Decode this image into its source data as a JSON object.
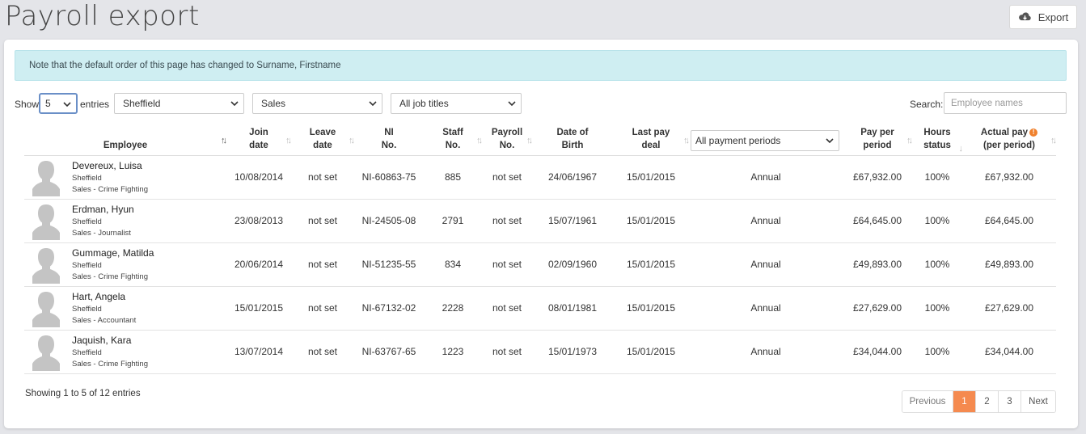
{
  "page": {
    "title": "Payroll export"
  },
  "toolbar": {
    "export_label": "Export"
  },
  "notice": "Note that the default order of this page has changed to Surname, Firstname",
  "filters": {
    "show_label": "Show",
    "page_length": "5",
    "entries_label": "entries",
    "location": "Sheffield",
    "department": "Sales",
    "job_title": "All job titles",
    "search_label": "Search:",
    "search_placeholder": "Employee names",
    "payment_period": "All payment periods"
  },
  "columns": {
    "employee": "Employee",
    "join_date_1": "Join",
    "join_date_2": "date",
    "leave_date_1": "Leave",
    "leave_date_2": "date",
    "ni_1": "NI",
    "ni_2": "No.",
    "staff_1": "Staff",
    "staff_2": "No.",
    "payroll_1": "Payroll",
    "payroll_2": "No.",
    "dob_1": "Date of",
    "dob_2": "Birth",
    "lastpay_1": "Last pay",
    "lastpay_2": "deal",
    "payper_1": "Pay per",
    "payper_2": "period",
    "hours_1": "Hours",
    "hours_2": "status",
    "actual_1": "Actual pay",
    "actual_2": "(per period)"
  },
  "rows": [
    {
      "name": "Devereux, Luisa",
      "location": "Sheffield",
      "role": "Sales - Crime Fighting",
      "join": "10/08/2014",
      "leave": "not set",
      "ni": "NI-60863-75",
      "staff": "885",
      "payroll": "not set",
      "dob": "24/06/1967",
      "lastpay": "15/01/2015",
      "period": "Annual",
      "payper": "£67,932.00",
      "hours": "100%",
      "actual": "£67,932.00"
    },
    {
      "name": "Erdman, Hyun",
      "location": "Sheffield",
      "role": "Sales - Journalist",
      "join": "23/08/2013",
      "leave": "not set",
      "ni": "NI-24505-08",
      "staff": "2791",
      "payroll": "not set",
      "dob": "15/07/1961",
      "lastpay": "15/01/2015",
      "period": "Annual",
      "payper": "£64,645.00",
      "hours": "100%",
      "actual": "£64,645.00"
    },
    {
      "name": "Gummage, Matilda",
      "location": "Sheffield",
      "role": "Sales - Crime Fighting",
      "join": "20/06/2014",
      "leave": "not set",
      "ni": "NI-51235-55",
      "staff": "834",
      "payroll": "not set",
      "dob": "02/09/1960",
      "lastpay": "15/01/2015",
      "period": "Annual",
      "payper": "£49,893.00",
      "hours": "100%",
      "actual": "£49,893.00"
    },
    {
      "name": "Hart, Angela",
      "location": "Sheffield",
      "role": "Sales - Accountant",
      "join": "15/01/2015",
      "leave": "not set",
      "ni": "NI-67132-02",
      "staff": "2228",
      "payroll": "not set",
      "dob": "08/01/1981",
      "lastpay": "15/01/2015",
      "period": "Annual",
      "payper": "£27,629.00",
      "hours": "100%",
      "actual": "£27,629.00"
    },
    {
      "name": "Jaquish, Kara",
      "location": "Sheffield",
      "role": "Sales - Crime Fighting",
      "join": "13/07/2014",
      "leave": "not set",
      "ni": "NI-63767-65",
      "staff": "1223",
      "payroll": "not set",
      "dob": "15/01/1973",
      "lastpay": "15/01/2015",
      "period": "Annual",
      "payper": "£34,044.00",
      "hours": "100%",
      "actual": "£34,044.00"
    }
  ],
  "footer": {
    "showing": "Showing 1 to 5 of 12 entries",
    "previous": "Previous",
    "pages": [
      "1",
      "2",
      "3"
    ],
    "next": "Next"
  },
  "colors": {
    "accent": "#f58a4f",
    "notice_bg": "#cfeef2",
    "info_icon": "#f0812d"
  }
}
